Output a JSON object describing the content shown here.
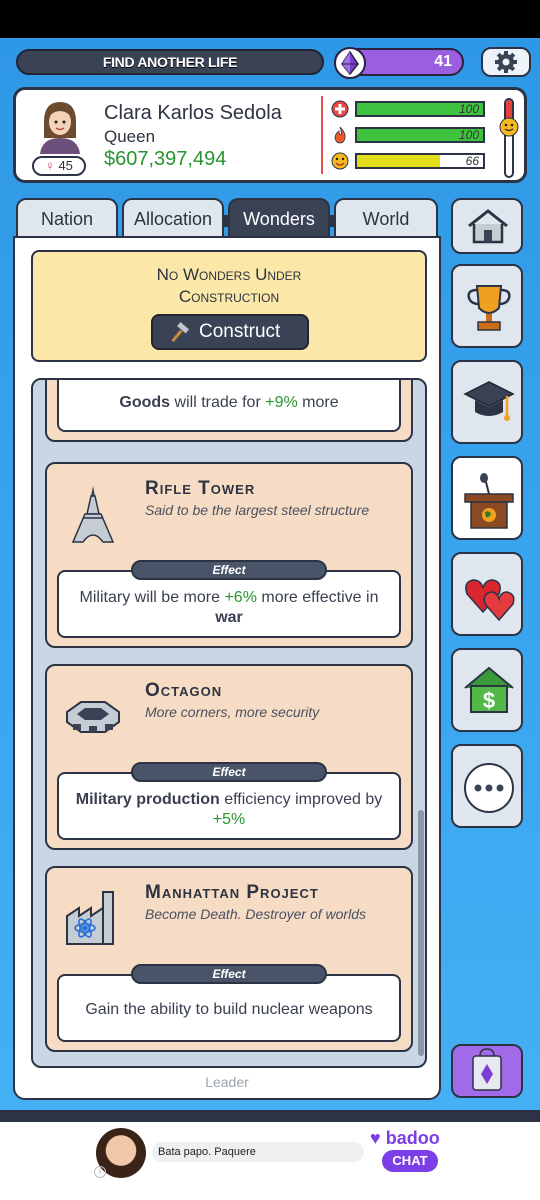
{
  "topbar": {
    "find_label": "FIND ANOTHER LIFE",
    "gem_count": "41",
    "gem_icon": "ethereum-gem-icon",
    "settings_icon": "gear-icon"
  },
  "leader": {
    "name": "Clara Karlos Sedola",
    "title": "Queen",
    "money": "$607,397,494",
    "age_symbol": "♀",
    "age": "45",
    "stats": [
      {
        "icon": "health-icon",
        "value": "100",
        "fill": 1.0,
        "color": "#3fc23f"
      },
      {
        "icon": "fire-icon",
        "value": "100",
        "fill": 1.0,
        "color": "#3fc23f"
      },
      {
        "icon": "happiness-icon",
        "value": "66",
        "fill": 0.66,
        "color": "#e3dc1a"
      }
    ]
  },
  "tabs": [
    "Nation",
    "Allocation",
    "Wonders",
    "World"
  ],
  "active_tab": "Wonders",
  "banner": {
    "line1": "No Wonders Under",
    "line2": "Construction",
    "construct_label": "Construct"
  },
  "partial_wonder": {
    "effect_bold": "Goods",
    "effect_mid": " will trade for ",
    "effect_green": "+9%",
    "effect_tail": " more"
  },
  "wonders": [
    {
      "title": "Rifle Tower",
      "subtitle": "Said to be the largest steel structure",
      "effect_label": "Effect",
      "effect_pre": "Military will be more ",
      "effect_green": "+6%",
      "effect_post": " more effective in ",
      "effect_bold": "war",
      "icon": "tower-icon"
    },
    {
      "title": "Octagon",
      "subtitle": "More corners, more security",
      "effect_label": "Effect",
      "effect_bold": "Military production",
      "effect_post": " efficiency improved by ",
      "effect_green": "+5%",
      "icon": "octagon-building-icon"
    },
    {
      "title": "Manhattan Project",
      "subtitle": "Become Death. Destroyer of worlds",
      "effect_label": "Effect",
      "effect_text": "Gain the ability to build nuclear weapons",
      "icon": "factory-atom-icon"
    }
  ],
  "panel_footer": "Leader",
  "side_buttons": [
    "home-icon",
    "trophy-icon",
    "graduation-cap-icon",
    "podium-icon",
    "hearts-icon",
    "house-dollar-icon",
    "more-icon"
  ],
  "ad": {
    "text": "Bata papo. Paquere",
    "brand": "badoo",
    "cta": "CHAT"
  }
}
